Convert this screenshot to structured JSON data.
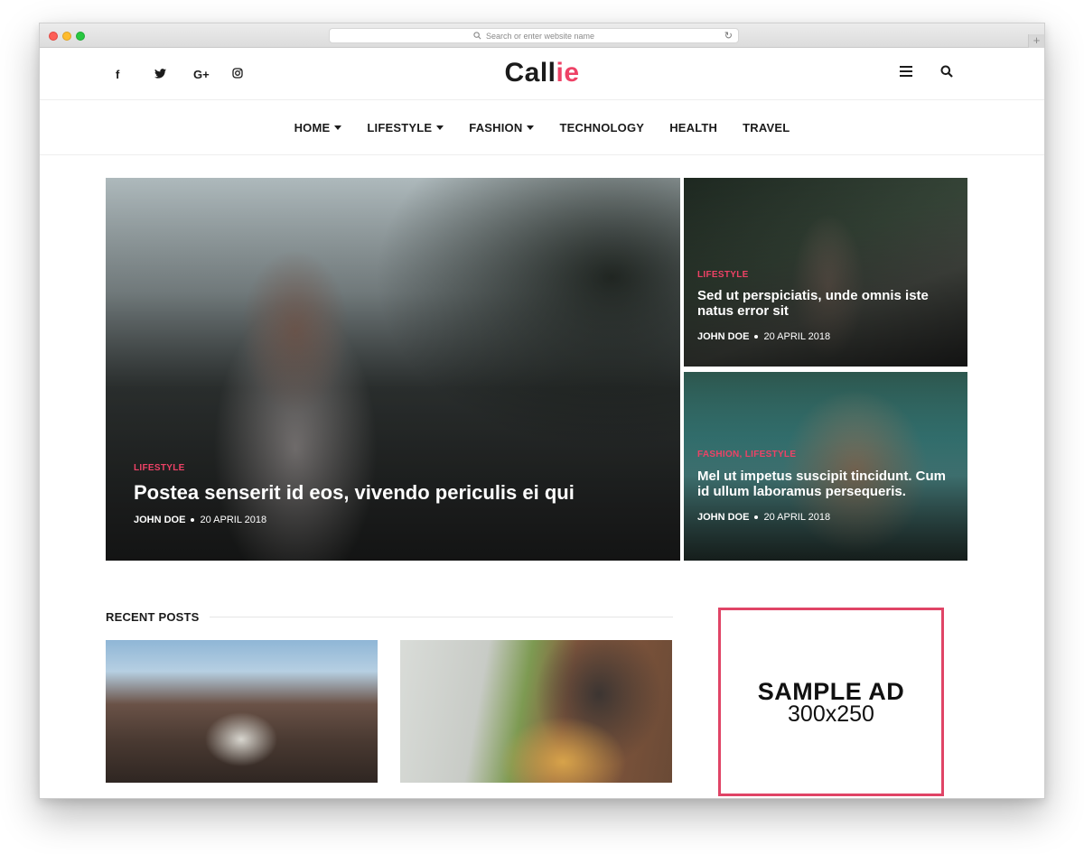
{
  "browser": {
    "url_placeholder": "Search or enter website name",
    "new_tab_label": "+"
  },
  "header": {
    "social": [
      {
        "name": "facebook-icon",
        "glyph": "f"
      },
      {
        "name": "twitter-icon",
        "glyph": "🐦"
      },
      {
        "name": "google-plus-icon",
        "glyph": "G+"
      },
      {
        "name": "instagram-icon",
        "glyph": "◎"
      }
    ],
    "logo_main": "Call",
    "logo_accent": "ie",
    "logo_tail": ""
  },
  "nav": {
    "items": [
      {
        "label": "HOME",
        "dropdown": true
      },
      {
        "label": "LIFESTYLE",
        "dropdown": true
      },
      {
        "label": "FASHION",
        "dropdown": true
      },
      {
        "label": "TECHNOLOGY",
        "dropdown": false
      },
      {
        "label": "HEALTH",
        "dropdown": false
      },
      {
        "label": "TRAVEL",
        "dropdown": false
      }
    ]
  },
  "featured": {
    "main": {
      "category": "LIFESTYLE",
      "title": "Postea senserit id eos, vivendo periculis ei qui",
      "author": "JOHN DOE",
      "date": "20 APRIL 2018"
    },
    "side_top": {
      "category": "LIFESTYLE",
      "title": "Sed ut perspiciatis, unde omnis iste natus error sit",
      "author": "JOHN DOE",
      "date": "20 APRIL 2018"
    },
    "side_bottom": {
      "category": "FASHION, LIFESTYLE",
      "title": "Mel ut impetus suscipit tincidunt. Cum id ullum laboramus persequeris.",
      "author": "JOHN DOE",
      "date": "20 APRIL 2018"
    }
  },
  "recent": {
    "section_title": "RECENT POSTS"
  },
  "ad": {
    "line1": "SAMPLE AD",
    "line2": "300x250"
  },
  "colors": {
    "accent": "#ee4266",
    "ad_border": "#e04466",
    "text": "#1b1b1b"
  }
}
